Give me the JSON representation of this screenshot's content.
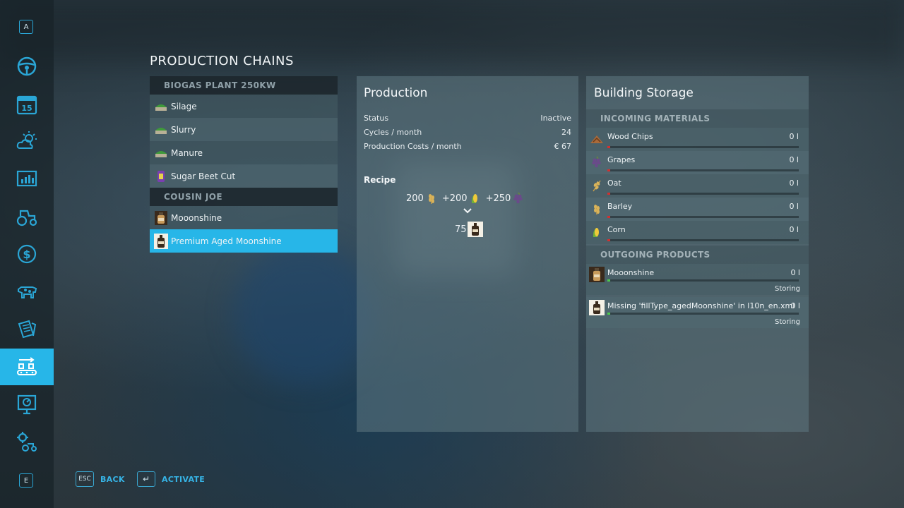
{
  "sidebar": {
    "top_key": "A",
    "bottom_key": "E",
    "items": [
      {
        "icon": "steering-wheel-icon"
      },
      {
        "icon": "calendar-icon",
        "day": "15"
      },
      {
        "icon": "weather-icon"
      },
      {
        "icon": "statistics-icon"
      },
      {
        "icon": "tractor-icon"
      },
      {
        "icon": "finance-icon"
      },
      {
        "icon": "animals-icon"
      },
      {
        "icon": "contracts-icon"
      },
      {
        "icon": "production-icon",
        "active": true
      },
      {
        "icon": "help-icon"
      },
      {
        "icon": "settings-icon"
      }
    ]
  },
  "page": {
    "title": "PRODUCTION CHAINS"
  },
  "chains": {
    "groups": [
      {
        "name": "BIOGAS PLANT 250KW",
        "items": [
          {
            "label": "Silage",
            "icon": "silage-icon"
          },
          {
            "label": "Slurry",
            "icon": "slurry-icon"
          },
          {
            "label": "Manure",
            "icon": "manure-icon"
          },
          {
            "label": "Sugar Beet Cut",
            "icon": "sugar-beet-icon"
          }
        ]
      },
      {
        "name": "COUSIN JOE",
        "items": [
          {
            "label": "Mooonshine",
            "icon": "moonshine-bottle-icon"
          },
          {
            "label": "Premium Aged Moonshine",
            "icon": "aged-moonshine-icon",
            "selected": true
          }
        ]
      }
    ]
  },
  "production": {
    "title": "Production",
    "status_label": "Status",
    "status_value": "Inactive",
    "cycles_label": "Cycles / month",
    "cycles_value": "24",
    "costs_label": "Production Costs / month",
    "costs_value": "€ 67",
    "recipe_label": "Recipe",
    "recipe_inputs": [
      {
        "amount": "200",
        "icon": "barley-icon",
        "prefix": ""
      },
      {
        "amount": "200",
        "icon": "corn-icon",
        "prefix": "+"
      },
      {
        "amount": "250",
        "icon": "grapes-icon",
        "prefix": "+"
      }
    ],
    "recipe_output": {
      "amount": "75",
      "icon": "aged-moonshine-icon"
    }
  },
  "storage": {
    "title": "Building Storage",
    "incoming_header": "INCOMING MATERIALS",
    "incoming": [
      {
        "name": "Wood Chips",
        "value": "0 l",
        "icon": "wood-chips-icon",
        "fill": 0
      },
      {
        "name": "Grapes",
        "value": "0 l",
        "icon": "grapes-icon",
        "fill": 0
      },
      {
        "name": "Oat",
        "value": "0 l",
        "icon": "oat-icon",
        "fill": 0
      },
      {
        "name": "Barley",
        "value": "0 l",
        "icon": "barley-icon",
        "fill": 0
      },
      {
        "name": "Corn",
        "value": "0 l",
        "icon": "corn-icon",
        "fill": 0
      }
    ],
    "outgoing_header": "OUTGOING PRODUCTS",
    "outgoing": [
      {
        "name": "Mooonshine",
        "value": "0 l",
        "status": "Storing",
        "icon": "moonshine-bottle-icon",
        "fill": 0
      },
      {
        "name": "Missing 'fillType_agedMoonshine' in l10n_en.xml",
        "value": "0 l",
        "status": "Storing",
        "icon": "aged-moonshine-icon",
        "fill": 0
      }
    ]
  },
  "footer": {
    "back_key": "ESC",
    "back_label": "BACK",
    "activate_key": "↵",
    "activate_label": "ACTIVATE"
  },
  "colors": {
    "accent": "#27b6e8",
    "empty_bar": "#d23030",
    "output_bar": "#4ccb4c"
  }
}
